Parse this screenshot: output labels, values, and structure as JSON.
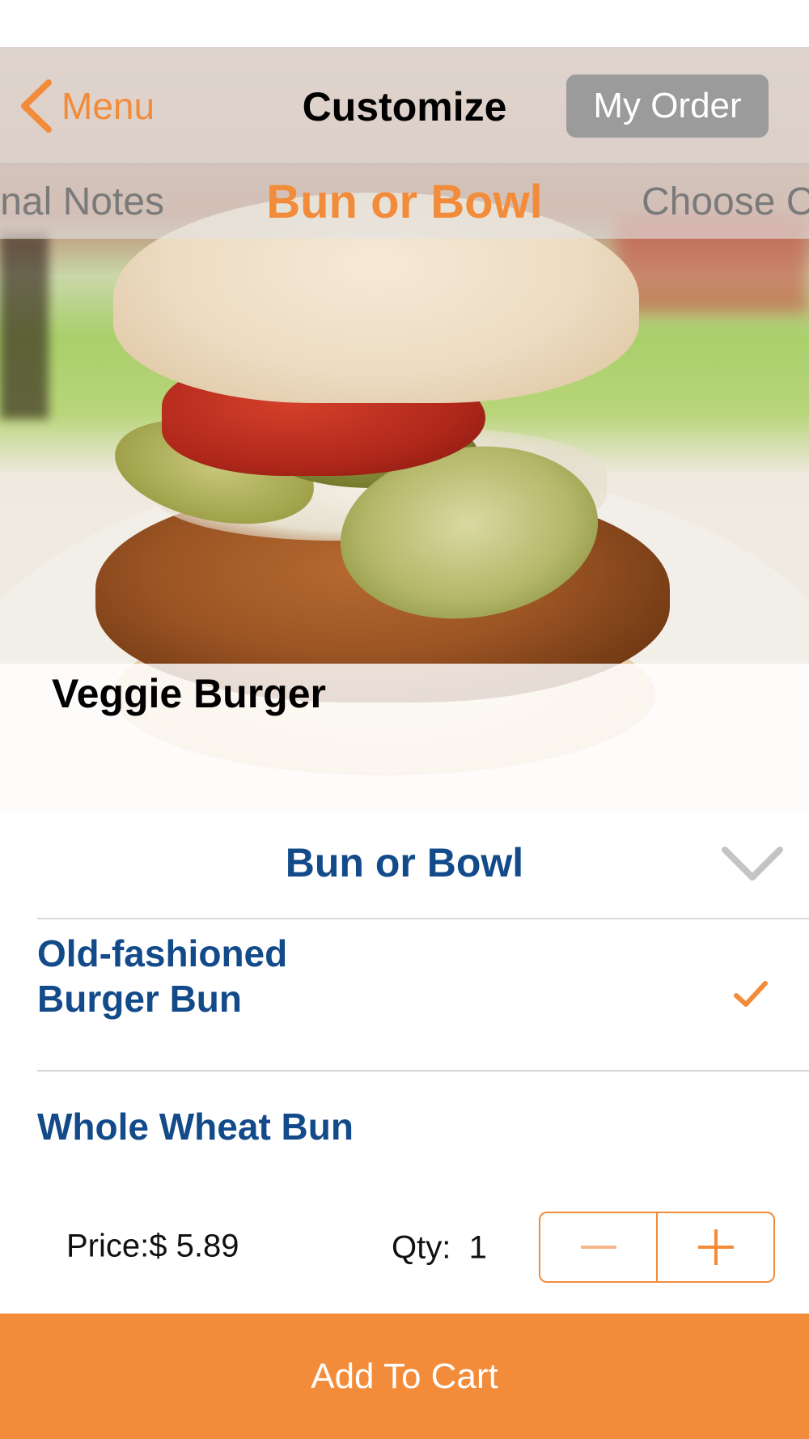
{
  "nav": {
    "back_label": "Menu",
    "title": "Customize",
    "order_label": "My Order"
  },
  "tabs": {
    "previous": "nal Notes",
    "active": "Bun or Bowl",
    "next": "Choose C"
  },
  "hero": {
    "image_icon": "veggie-burger-photo",
    "item_name": "Veggie Burger"
  },
  "section": {
    "title": "Bun or Bowl",
    "expanded": true
  },
  "options": [
    {
      "label_line1": "Old-fashioned",
      "label_line2": "Burger Bun",
      "selected": true
    },
    {
      "label": "Whole Wheat Bun",
      "selected": false
    }
  ],
  "order": {
    "price_text": "Price:$ 5.89",
    "qty_text": "Qty:  1",
    "quantity": 1
  },
  "actions": {
    "add_to_cart": "Add To Cart"
  },
  "colors": {
    "accent": "#f28c3a",
    "option_text": "#124a8a",
    "my_order_bg": "#9b9b9b"
  }
}
